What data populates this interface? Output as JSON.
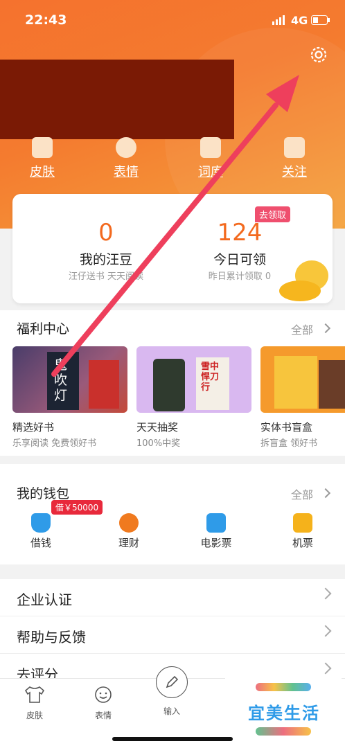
{
  "status_bar": {
    "time": "22:43",
    "network": "4G"
  },
  "header": {
    "categories": [
      {
        "label": "皮肤",
        "icon": "shirt-icon"
      },
      {
        "label": "表情",
        "icon": "face-icon"
      },
      {
        "label": "词库",
        "icon": "book-icon"
      },
      {
        "label": "关注",
        "icon": "bookmark-icon"
      }
    ]
  },
  "points": {
    "left": {
      "value": "0",
      "title": "我的汪豆",
      "subtitle": "汪仔送书 天天阅读"
    },
    "right": {
      "value": "124",
      "title": "今日可领",
      "subtitle": "昨日累计领取 0",
      "tag": "去领取"
    }
  },
  "welfare": {
    "title": "福利中心",
    "more": "全部",
    "items": [
      {
        "title": "精选好书",
        "subtitle": "乐享阅读 免费领好书",
        "cover_text": "鬼吹灯"
      },
      {
        "title": "天天抽奖",
        "subtitle": "100%中奖",
        "cover_text": "雪中悍刀行"
      },
      {
        "title": "实体书盲盒",
        "subtitle": "拆盲盒 领好书"
      }
    ]
  },
  "wallet": {
    "title": "我的钱包",
    "more": "全部",
    "loan_tag": "借￥50000",
    "items": [
      {
        "label": "借钱",
        "icon": "money-bag-icon",
        "color": "#2f9be8"
      },
      {
        "label": "理财",
        "icon": "yen-coin-icon",
        "color": "#f07a1f"
      },
      {
        "label": "电影票",
        "icon": "film-icon",
        "color": "#2f9be8"
      },
      {
        "label": "机票",
        "icon": "plane-icon",
        "color": "#f5b21b"
      }
    ]
  },
  "menu": [
    {
      "label": "企业认证"
    },
    {
      "label": "帮助与反馈"
    },
    {
      "label": "去评分"
    }
  ],
  "tabbar": [
    {
      "label": "皮肤",
      "icon": "shirt-icon"
    },
    {
      "label": "表情",
      "icon": "smile-icon"
    },
    {
      "label": "输入",
      "icon": "pen-icon"
    }
  ],
  "watermark": {
    "text": "宜美生活"
  },
  "colors": {
    "brand_orange": "#f5722e",
    "accent_red": "#ee3f5c",
    "tag_pink": "#ef4f6e"
  }
}
